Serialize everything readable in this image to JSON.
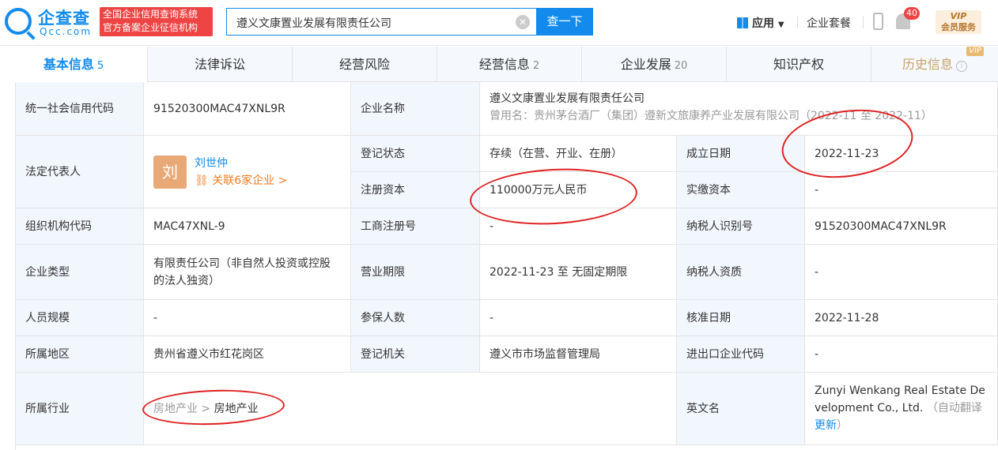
{
  "header": {
    "logo_cn": "企查查",
    "logo_en": "Qcc.com",
    "badge_line1": "全国企业信用查询系统",
    "badge_line2": "官方备案企业征信机构",
    "search_value": "遵义文康置业发展有限责任公司",
    "search_button": "查一下",
    "app_label": "应用",
    "package_label": "企业套餐",
    "notification_count": "40",
    "vip_line1": "VIP",
    "vip_line2": "会员服务"
  },
  "tabs": [
    {
      "label": "基本信息",
      "count": "5"
    },
    {
      "label": "法律诉讼",
      "count": ""
    },
    {
      "label": "经营风险",
      "count": ""
    },
    {
      "label": "经营信息",
      "count": "2"
    },
    {
      "label": "企业发展",
      "count": "20"
    },
    {
      "label": "知识产权",
      "count": ""
    },
    {
      "label": "历史信息",
      "count": "",
      "flag": "VIP"
    }
  ],
  "info": {
    "credit_code_label": "统一社会信用代码",
    "credit_code": "91520300MAC47XNL9R",
    "name_label": "企业名称",
    "name": "遵义文康置业发展有限责任公司",
    "former_name": "曾用名：贵州茅台酒厂（集团）遵新文旅康养产业发展有限公司（2022-11 至 2022-11）",
    "legal_rep_label": "法定代表人",
    "legal_rep_avatar": "刘",
    "legal_rep_name": "刘世仲",
    "legal_rep_related": "关联6家企业 >",
    "reg_status_label": "登记状态",
    "reg_status": "存续（在营、开业、在册）",
    "founded_label": "成立日期",
    "founded": "2022-11-23",
    "reg_capital_label": "注册资本",
    "reg_capital": "110000万元人民币",
    "paid_capital_label": "实缴资本",
    "paid_capital": "-",
    "org_code_label": "组织机构代码",
    "org_code": "MAC47XNL-9",
    "biz_reg_no_label": "工商注册号",
    "biz_reg_no": "-",
    "taxpayer_id_label": "纳税人识别号",
    "taxpayer_id": "91520300MAC47XNL9R",
    "type_label": "企业类型",
    "type": "有限责任公司（非自然人投资或控股的法人独资）",
    "term_label": "营业期限",
    "term": "2022-11-23 至 无固定期限",
    "taxpayer_qual_label": "纳税人资质",
    "taxpayer_qual": "-",
    "staff_label": "人员规模",
    "staff": "-",
    "insured_label": "参保人数",
    "insured": "-",
    "approval_label": "核准日期",
    "approval": "2022-11-28",
    "region_label": "所属地区",
    "region": "贵州省遵义市红花岗区",
    "authority_label": "登记机关",
    "authority": "遵义市市场监督管理局",
    "import_export_label": "进出口企业代码",
    "import_export": "-",
    "industry_label": "所属行业",
    "industry_parent": "房地产业",
    "industry_sep": ">",
    "industry_child": "房地产业",
    "english_label": "英文名",
    "english_name": "Zunyi Wenkang Real Estate Development Co., Ltd.",
    "auto_translate": "（自动翻译",
    "translate_more": "更新",
    "translate_close": "）"
  },
  "colors": {
    "accent": "#128bed",
    "annotation": "#e02020",
    "label_bg": "#f2f6fd"
  }
}
